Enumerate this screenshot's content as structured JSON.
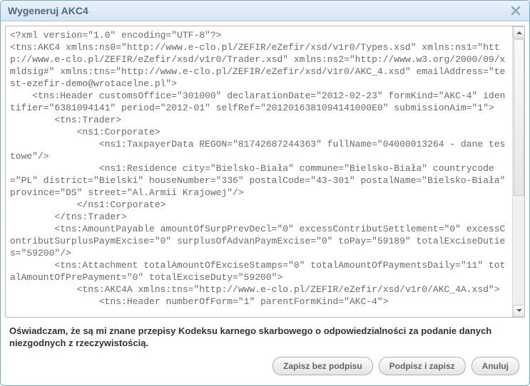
{
  "dialog": {
    "title": "Wygeneruj AKC4",
    "declaration": "Oświadczam, że są mi znane przepisy Kodeksu karnego skarbowego o odpowiedzialności za podanie danych niezgodnych z rzeczywistością.",
    "buttons": {
      "save_no_sign": "Zapisz bez podpisu",
      "sign_and_save": "Podpisz i zapisz",
      "cancel": "Anuluj"
    },
    "xml_content": "<?xml version=\"1.0\" encoding=\"UTF-8\"?>\n<tns:AKC4 xmlns:ns0=\"http://www.e-clo.pl/ZEFIR/eZefir/xsd/v1r0/Types.xsd\" xmlns:ns1=\"http://www.e-clo.pl/ZEFIR/eZefir/xsd/v1r0/Trader.xsd\" xmlns:ns2=\"http://www.w3.org/2000/09/xmldsig#\" xmlns:tns=\"http://www.e-clo.pl/ZEFIR/eZefir/xsd/v1r0/AKC_4.xsd\" emailAddress=\"test-ezefir-demo@wrotacelne.pl\">\n    <tns:Header customsOffice=\"301000\" declarationDate=\"2012-02-23\" formKind=\"AKC-4\" identifier=\"6381094141\" period=\"2012-01\" selfRef=\"2012016381094141000E0\" submissionAim=\"1\">\n        <tns:Trader>\n            <ns1:Corporate>\n                <ns1:TaxpayerData REGON=\"81742687244363\" fullName=\"04000013264 - dane testowe\"/>\n                <ns1:Residence city=\"Bielsko-Biała\" commune=\"Bielsko-Biała\" countrycode=\"PL\" district=\"Bielski\" houseNumber=\"336\" postalCode=\"43-301\" postalName=\"Bielsko-Biała\" province=\"DS\" street=\"Al.Armii Krajowej\"/>\n            </ns1:Corporate>\n        </tns:Trader>\n        <tns:AmountPayable amountOfSurpPrevDecl=\"0\" excessContributSettlement=\"0\" excessContributSurplusPaymExcise=\"0\" surplusOfAdvanPaymExcise=\"0\" toPay=\"59189\" totalExciseDuties=\"59200\"/>\n        <tns:Attachment totalAmountOfExciseStamps=\"0\" totalAmountOfPaymentsDaily=\"11\" totalAmountOfPrePayment=\"0\" totalExciseDuty=\"59200\">\n            <tns:AKC4A xmlns:tns=\"http://www.e-clo.pl/ZEFIR/eZefir/xsd/v1r0/AKC_4A.xsd\">\n                <tns:Header numberOfForm=\"1\" parentFormKind=\"AKC-4\">"
  }
}
